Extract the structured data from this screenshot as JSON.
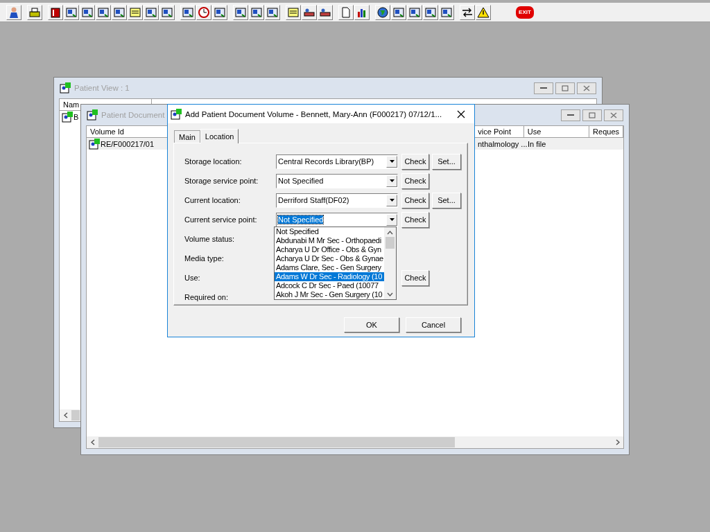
{
  "toolbar": {
    "exit_label": "EXIT"
  },
  "patient_view": {
    "title": "Patient View : 1",
    "columns": [
      "Nam"
    ],
    "rows": [
      [
        "B"
      ]
    ]
  },
  "document_window": {
    "title": "Patient Document",
    "columns": [
      "Volume Id",
      "vice Point",
      "Use",
      "Reques"
    ],
    "rows": [
      {
        "cells": [
          "RE/F000217/01",
          "nthalmology ...",
          "In file"
        ],
        "selected": true
      }
    ]
  },
  "dialog": {
    "title": "Add Patient Document Volume - Bennett, Mary-Ann (F000217) 07/12/1...",
    "tabs": [
      {
        "label": "Main",
        "selected": false
      },
      {
        "label": "Location",
        "selected": true
      }
    ],
    "fields": [
      {
        "label": "Storage location:",
        "value": "Central Records Library(BP)",
        "buttons": [
          "Check",
          "Set..."
        ]
      },
      {
        "label": "Storage service point:",
        "value": "Not Specified",
        "buttons": [
          "Check"
        ]
      },
      {
        "label": "Current location:",
        "value": "Derriford Staff(DF02)",
        "buttons": [
          "Check",
          "Set..."
        ]
      },
      {
        "label": "Current service point:",
        "value": "Not Specified",
        "text_selected": true,
        "buttons": [
          "Check"
        ]
      },
      {
        "label": "Volume status:"
      },
      {
        "label": "Media type:"
      },
      {
        "label": "Use:",
        "buttons": [
          "Check"
        ]
      },
      {
        "label": "Required on:"
      }
    ],
    "dropdown": {
      "items": [
        {
          "label": "Not Specified",
          "selected": false
        },
        {
          "label": "Abdunabi M Mr Sec - Orthopaedi",
          "selected": false
        },
        {
          "label": "Acharya U Dr Office - Obs & Gyn",
          "selected": false
        },
        {
          "label": "Acharya U Dr Sec - Obs & Gynae",
          "selected": false
        },
        {
          "label": "Adams Clare, Sec - Gen Surgery",
          "selected": false
        },
        {
          "label": "Adams W Dr Sec - Radiology (10",
          "selected": true
        },
        {
          "label": "Adcock C Dr Sec - Paed (10077",
          "selected": false
        },
        {
          "label": "Akoh J Mr Sec - Gen Surgery (10",
          "selected": false
        }
      ]
    },
    "buttons": [
      "OK",
      "Cancel"
    ]
  }
}
